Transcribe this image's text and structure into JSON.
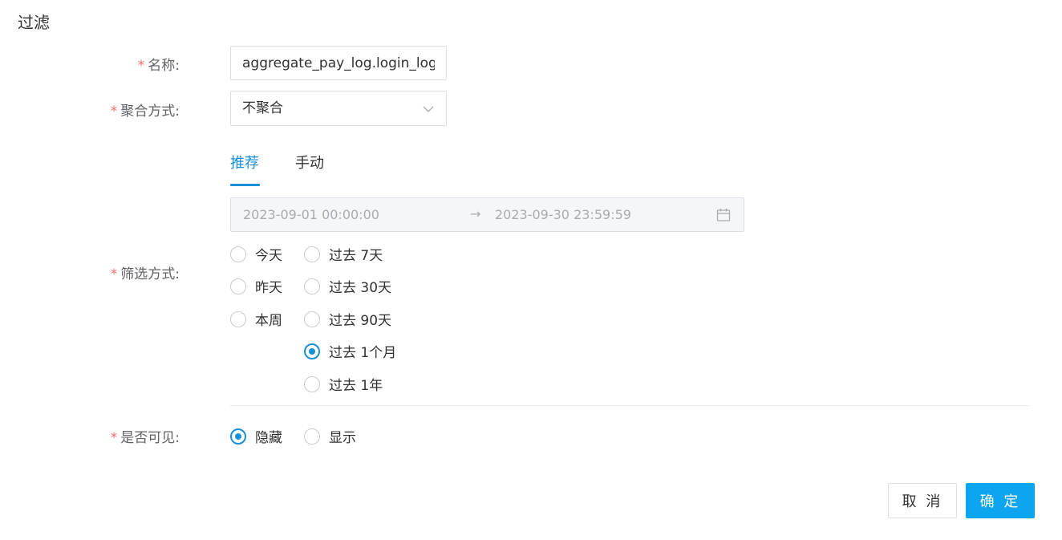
{
  "dialog": {
    "title": "过滤"
  },
  "form": {
    "name": {
      "label": "名称:",
      "value": "aggregate_pay_log.login_log"
    },
    "aggregation": {
      "label": "聚合方式:",
      "selected": "不聚合"
    },
    "filter": {
      "label": "筛选方式:",
      "tabs": [
        {
          "label": "推荐",
          "active": true
        },
        {
          "label": "手动",
          "active": false
        }
      ],
      "range": {
        "start": "2023-09-01 00:00:00",
        "separator": "→",
        "end": "2023-09-30 23:59:59"
      },
      "options": [
        {
          "label": "今天",
          "checked": false
        },
        {
          "label": "昨天",
          "checked": false
        },
        {
          "label": "本周",
          "checked": false
        },
        {
          "label": "过去 7天",
          "checked": false
        },
        {
          "label": "过去 30天",
          "checked": false
        },
        {
          "label": "过去 90天",
          "checked": false
        },
        {
          "label": "过去 1个月",
          "checked": true
        },
        {
          "label": "过去 1年",
          "checked": false
        }
      ]
    },
    "visibility": {
      "label": "是否可见:",
      "options": [
        {
          "label": "隐藏",
          "checked": true
        },
        {
          "label": "显示",
          "checked": false
        }
      ]
    },
    "required_mark": "*"
  },
  "actions": {
    "cancel": "取 消",
    "ok": "确 定"
  },
  "colors": {
    "accent": "#1890d8",
    "primary_button": "#0ea5f0",
    "required": "#f56c6c"
  },
  "icons": {
    "select_arrow": "chevron-down-icon",
    "date_picker": "calendar-icon"
  }
}
